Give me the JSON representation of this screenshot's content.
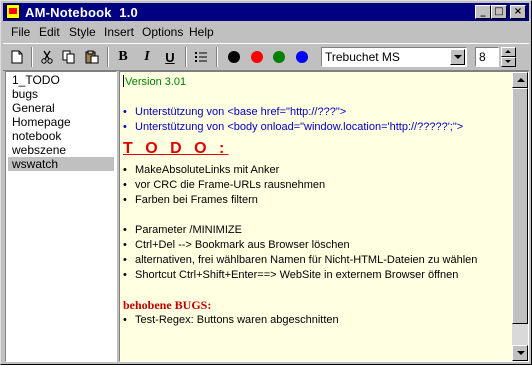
{
  "window": {
    "title": "AM-Notebook  1.0",
    "controls": {
      "minimize": "_",
      "maximize": "□",
      "close": "×"
    }
  },
  "menu": [
    "File",
    "Edit",
    "Style",
    "Insert",
    "Options",
    "Help"
  ],
  "toolbar": {
    "colors": [
      "#000000",
      "#ff0000",
      "#008000",
      "#0000ff"
    ],
    "bold_label": "B",
    "italic_label": "I",
    "underline_label": "U",
    "font_name": "Trebuchet MS",
    "font_size": "8"
  },
  "sidebar": {
    "items": [
      "1_TODO",
      "bugs",
      "General",
      "Homepage",
      "notebook",
      "webszene",
      "wswatch"
    ],
    "selected": "wswatch"
  },
  "editor": {
    "version": "Version 3.01",
    "intro_bullets": [
      "Unterstützung von <base href=\"http://???\">",
      "Unterstützung von <body onload=\"window.location='http://?????';\">"
    ],
    "todo_heading": "T O D O :",
    "todo_items_1": [
      "MakeAbsoluteLinks mit Anker",
      "vor CRC die Frame-URLs rausnehmen",
      "Farben bei Frames filtern"
    ],
    "todo_items_2": [
      "Parameter /MINIMIZE",
      "Ctrl+Del --> Bookmark aus Browser löschen",
      "alternativen, frei wählbaren Namen für Nicht-HTML-Dateien zu wählen",
      "Shortcut Ctrl+Shift+Enter==> WebSite in externem Browser öffnen"
    ],
    "bugs_heading": "behobene BUGS:",
    "bugs_items": [
      "Test-Regex: Buttons waren abgeschnitten"
    ]
  }
}
